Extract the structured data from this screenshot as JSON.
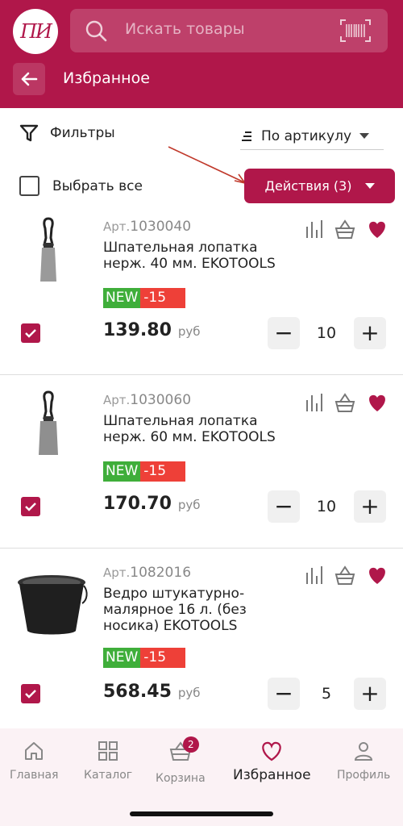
{
  "header": {
    "logo_text": "ПИ",
    "search_placeholder": "Искать товары",
    "page_title": "Избранное"
  },
  "toolbar": {
    "filters_label": "Фильтры",
    "sort_label": "По артикулу",
    "select_all_label": "Выбрать все",
    "actions_label": "Действия (3)"
  },
  "products": [
    {
      "art_prefix": "Арт.",
      "art_num": "1030040",
      "name": "Шпательная лопатка нерж. 40 мм. EKOTOOLS",
      "badge_new": "NEW",
      "badge_discount": "-15",
      "price": "139.80",
      "currency": "руб",
      "qty": "10",
      "checked": true
    },
    {
      "art_prefix": "Арт.",
      "art_num": "1030060",
      "name": "Шпательная лопатка нерж. 60 мм. EKOTOOLS",
      "badge_new": "NEW",
      "badge_discount": "-15",
      "price": "170.70",
      "currency": "руб",
      "qty": "10",
      "checked": true
    },
    {
      "art_prefix": "Арт.",
      "art_num": "1082016",
      "name": "Ведро штукатурно-малярное 16 л. (без носика)  EKOTOOLS",
      "badge_new": "NEW",
      "badge_discount": "-15",
      "price": "568.45",
      "currency": "руб",
      "qty": "5",
      "checked": true
    }
  ],
  "nav": {
    "home": "Главная",
    "catalog": "Каталог",
    "cart": "Корзина",
    "cart_count": "2",
    "favorites": "Избранное",
    "profile": "Профиль"
  },
  "colors": {
    "brand": "#b0174a",
    "new_badge": "#3fae3a",
    "discount_badge": "#ee4038"
  },
  "qty_controls": {
    "minus": "−",
    "plus": "+"
  }
}
